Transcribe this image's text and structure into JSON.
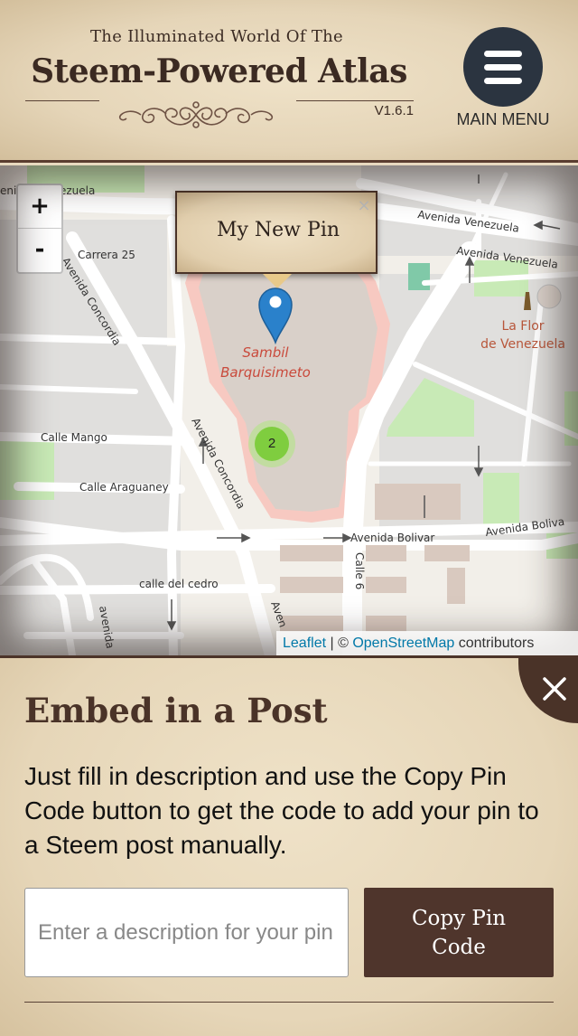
{
  "header": {
    "subtitle": "The Illuminated World Of The",
    "title": "Steem-Powered Atlas",
    "version": "V1.6.1",
    "menu_label": "MAIN MENU",
    "menu_icon": "hamburger-icon"
  },
  "map": {
    "zoom_in": "+",
    "zoom_out": "-",
    "popup_text": "My New Pin",
    "popup_close": "×",
    "cluster_count": "2",
    "labels": {
      "venezuela_left": "ezuela",
      "avenida_venezuela_1": "Avenida Venezuela",
      "avenida_venezuela_2": "Avenida Venezuela",
      "carrera_25": "Carrera 25",
      "avenida_concordia_1": "Avenida Concordia",
      "avenida_concordia_2": "Avenida Concordia",
      "sambil_1": "Sambil",
      "sambil_2": "Barquisimeto",
      "la_flor_1": "La Flor",
      "la_flor_2": "de Venezuela",
      "calle_mango": "Calle Mango",
      "calle_araguaney": "Calle Araguaney",
      "avenida_bolivar_1": "Avenida Bolivar",
      "avenida_bolivar_2": "Avenida Boliva",
      "calle_6": "Calle 6",
      "calle_del_cedro": "calle del cedro",
      "avenida_bottom": "avenida",
      "aven_bottom": "Aven",
      "eni_left": "eni"
    },
    "attribution": {
      "leaflet": "Leaflet",
      "separator": " | © ",
      "osm": "OpenStreetMap",
      "suffix": " contributors"
    },
    "colors": {
      "marker": "#2a81cb",
      "cluster": "#7fcd3f",
      "mall": "#d9d0c9",
      "park": "#c8eab6",
      "road_label": "#333333"
    }
  },
  "panel": {
    "title": "Embed in a Post",
    "description": "Just fill in description and use the Copy Pin Code button to get the code to add your pin to a Steem post manually.",
    "input_placeholder": "Enter a description for your pin",
    "copy_button": "Copy Pin Code",
    "close_icon": "close-icon"
  }
}
